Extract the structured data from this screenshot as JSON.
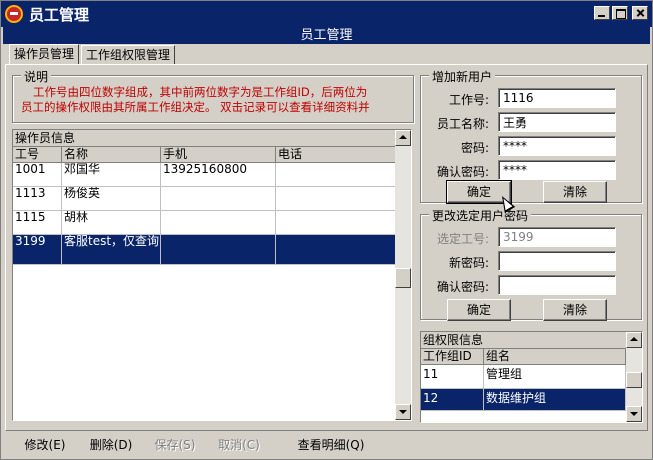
{
  "window": {
    "title": "员工管理",
    "banner": "员工管理"
  },
  "tabs": [
    "操作员管理",
    "工作组权限管理"
  ],
  "description": {
    "label": "说明",
    "line1": "工作号由四位数字组成，其中前两位数字为是工作组ID，后两位为",
    "line2": "员工的操作权限由其所属工作组决定。  双击记录可以查看详细资料并"
  },
  "operators": {
    "caption": "操作员信息",
    "columns": [
      "工号",
      "名称",
      "手机",
      "电话"
    ],
    "rows": [
      {
        "id": "1001",
        "name": "邓国华",
        "mobile": "13925160800",
        "phone": ""
      },
      {
        "id": "1113",
        "name": "杨俊英",
        "mobile": "",
        "phone": ""
      },
      {
        "id": "1115",
        "name": "胡林",
        "mobile": "",
        "phone": ""
      },
      {
        "id": "3199",
        "name": "客服test，仅查询",
        "mobile": "",
        "phone": ""
      }
    ],
    "selected_index": 3
  },
  "add_user": {
    "label": "增加新用户",
    "id_label": "工作号:",
    "id_value": "1116",
    "name_label": "员工名称:",
    "name_value": "王勇",
    "pwd_label": "密码:",
    "pwd_value": "****",
    "confirm_label": "确认密码:",
    "confirm_value": "****",
    "ok": "确定",
    "clear": "清除"
  },
  "change_pwd": {
    "label": "更改选定用户密码",
    "sel_label": "选定工号:",
    "sel_value": "3199",
    "new_label": "新密码:",
    "new_value": "",
    "confirm_label": "确认密码:",
    "confirm_value": "",
    "ok": "确定",
    "clear": "清除"
  },
  "groups": {
    "caption": "组权限信息",
    "columns": [
      "工作组ID",
      "组名"
    ],
    "rows": [
      {
        "id": "11",
        "name": "管理组"
      },
      {
        "id": "12",
        "name": "数据维护组"
      }
    ],
    "selected_index": 1
  },
  "toolbar": {
    "edit": "修改(E)",
    "delete": "删除(D)",
    "save": "保存(S)",
    "cancel": "取消(C)",
    "details": "查看明细(Q)"
  },
  "colors": {
    "titlebar": "#0a246a",
    "selection": "#0a246a",
    "description_text": "#c00000",
    "face": "#d4d0c8"
  }
}
